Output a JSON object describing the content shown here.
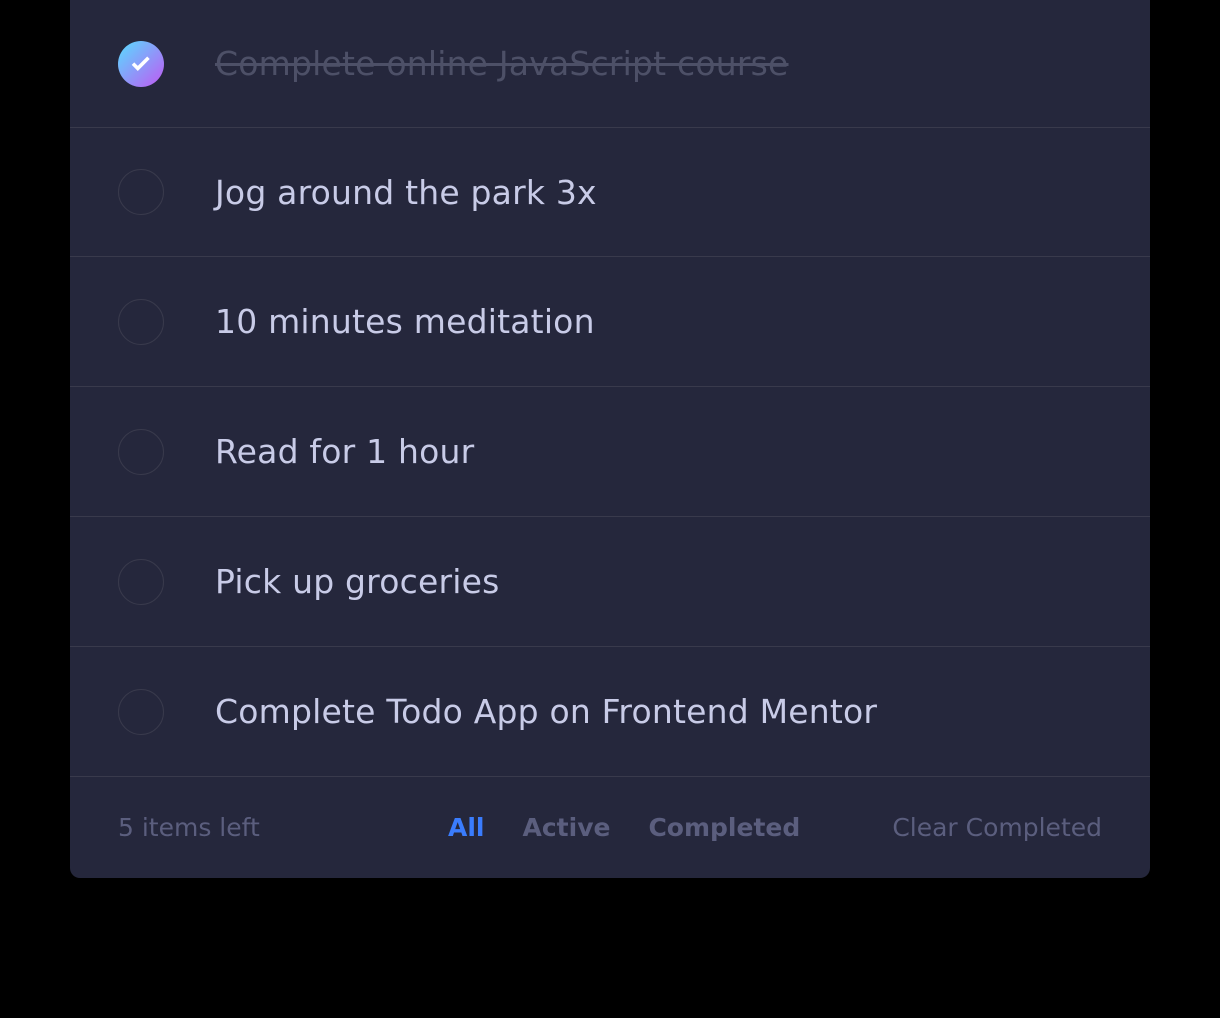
{
  "todos": [
    {
      "text": "Complete online JavaScript course",
      "completed": true
    },
    {
      "text": "Jog around the park 3x",
      "completed": false
    },
    {
      "text": "10 minutes meditation",
      "completed": false
    },
    {
      "text": "Read for 1 hour",
      "completed": false
    },
    {
      "text": "Pick up groceries",
      "completed": false
    },
    {
      "text": "Complete Todo App on Frontend Mentor",
      "completed": false
    }
  ],
  "footer": {
    "items_left": "5 items left",
    "filters": {
      "all": "All",
      "active": "Active",
      "completed": "Completed"
    },
    "active_filter": "all",
    "clear_label": "Clear Completed"
  },
  "colors": {
    "card_bg": "#25273c",
    "page_bg": "#000000",
    "text": "#c8cbe7",
    "muted": "#5b5e7e",
    "accent": "#3a7cfd",
    "check_gradient_start": "#57ddff",
    "check_gradient_end": "#c058f3"
  },
  "icons": {
    "completed_check": "check-icon"
  }
}
